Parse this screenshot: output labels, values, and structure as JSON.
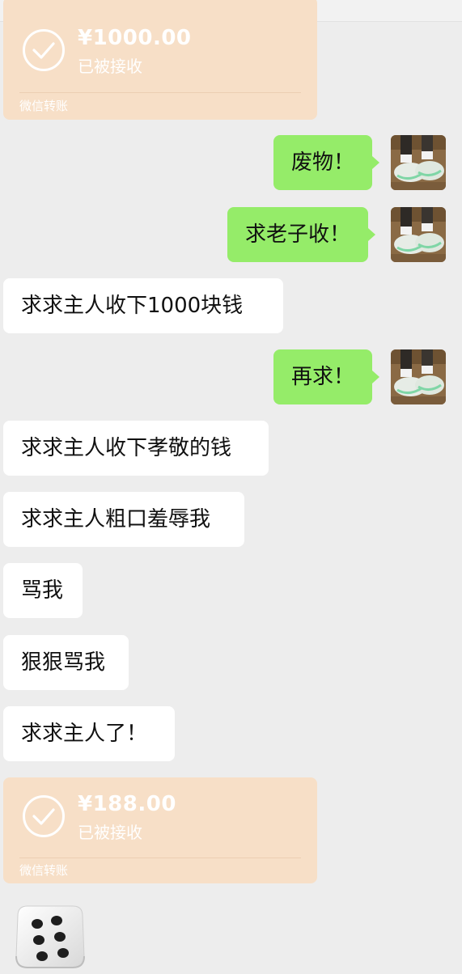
{
  "transfers": [
    {
      "amount": "¥1000.00",
      "status": "已被接收",
      "footer": "微信转账"
    },
    {
      "amount": "¥188.00",
      "status": "已被接收",
      "footer": "微信转账"
    }
  ],
  "messages": [
    {
      "side": "right",
      "text": "废物！"
    },
    {
      "side": "right",
      "text": "求老子收！"
    },
    {
      "side": "left",
      "text": "求求主人收下1000块钱"
    },
    {
      "side": "right",
      "text": "再求！"
    },
    {
      "side": "left",
      "text": "求求主人收下孝敬的钱"
    },
    {
      "side": "left",
      "text": "求求主人粗口羞辱我"
    },
    {
      "side": "left",
      "text": "骂我"
    },
    {
      "side": "left",
      "text": "狠狠骂我"
    },
    {
      "side": "left",
      "text": "求求主人了！"
    }
  ],
  "colors": {
    "background": "#ededed",
    "transfer_card": "#f7dfc7",
    "bubble_self": "#95ec69",
    "bubble_other": "#ffffff"
  },
  "icons": {
    "transfer_status": "check-circle-icon",
    "sticker": "dice-icon"
  }
}
